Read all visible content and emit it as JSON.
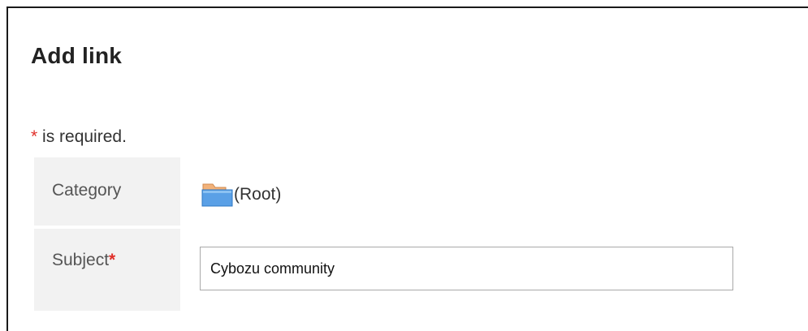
{
  "page": {
    "title": "Add link"
  },
  "required_note": {
    "asterisk": "*",
    "text": " is required."
  },
  "form": {
    "category": {
      "label": "Category",
      "value": "(Root)",
      "icon": "folder-icon"
    },
    "subject": {
      "label": "Subject",
      "required_marker": "*",
      "value": "Cybozu community",
      "placeholder": ""
    }
  },
  "colors": {
    "required": "#e0302a",
    "label_background": "#f2f2f2",
    "folder_blue": "#5aa0e6",
    "folder_orange": "#f2b27a"
  }
}
